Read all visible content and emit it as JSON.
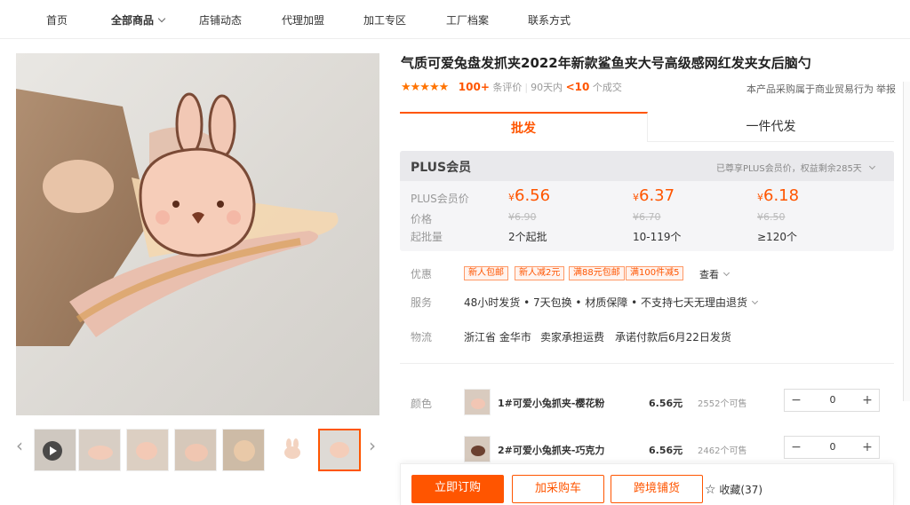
{
  "nav": {
    "items": [
      {
        "label": "首页"
      },
      {
        "label": "全部商品",
        "has_caret": true
      },
      {
        "label": "店铺动态"
      },
      {
        "label": "代理加盟"
      },
      {
        "label": "加工专区"
      },
      {
        "label": "工厂档案"
      },
      {
        "label": "联系方式"
      }
    ]
  },
  "product": {
    "title": "气质可爱兔盘发抓夹2022年新款鲨鱼夹大号高级感网红发夹女后脑勺",
    "stars": "★★★★★",
    "review_count": "100+",
    "review_label": "条评价",
    "sales_period": "90天内",
    "sales_count": "<10",
    "sales_unit": "个成交",
    "trade_note": "本产品采购属于商业贸易行为",
    "report_label": "举报"
  },
  "tabs": {
    "active": "批发",
    "other": "一件代发"
  },
  "plus": {
    "title": "PLUS会员",
    "note": "已尊享PLUS会员价，权益剩余285天",
    "labels": {
      "plus_price": "PLUS会员价",
      "price": "价格",
      "min_qty": "起批量"
    },
    "currency": "¥",
    "tiers": [
      {
        "plus_price": "6.56",
        "price": "¥6.90",
        "qty": "2个起批"
      },
      {
        "plus_price": "6.37",
        "price": "¥6.70",
        "qty": "10-119个"
      },
      {
        "plus_price": "6.18",
        "price": "¥6.50",
        "qty": "≥120个"
      }
    ]
  },
  "promo": {
    "label": "优惠",
    "coupons": [
      "新人包邮",
      "新人减2元",
      "满88元包邮",
      "满100件减5"
    ],
    "more": "查看"
  },
  "service": {
    "label": "服务",
    "text": "48小时发货 • 7天包换 • 材质保障 • 不支持七天无理由退货"
  },
  "logistics": {
    "label": "物流",
    "origin": "浙江省 金华市",
    "shipping": "卖家承担运费",
    "ship_time": "承诺付款后6月22日发货"
  },
  "variants": {
    "label": "颜色",
    "items": [
      {
        "name": "1#可爱小兔抓夹-樱花粉",
        "price": "6.56元",
        "stock": "2552个可售",
        "qty": "0"
      },
      {
        "name": "2#可爱小兔抓夹-巧克力",
        "price": "6.56元",
        "stock": "2462个可售",
        "qty": "0"
      }
    ]
  },
  "actions": {
    "buy": "立即订购",
    "cart": "加采购车",
    "cross": "跨境铺货",
    "favorite": "收藏(37)"
  },
  "colors": {
    "accent": "#ff5500",
    "star": "#ff7300"
  }
}
